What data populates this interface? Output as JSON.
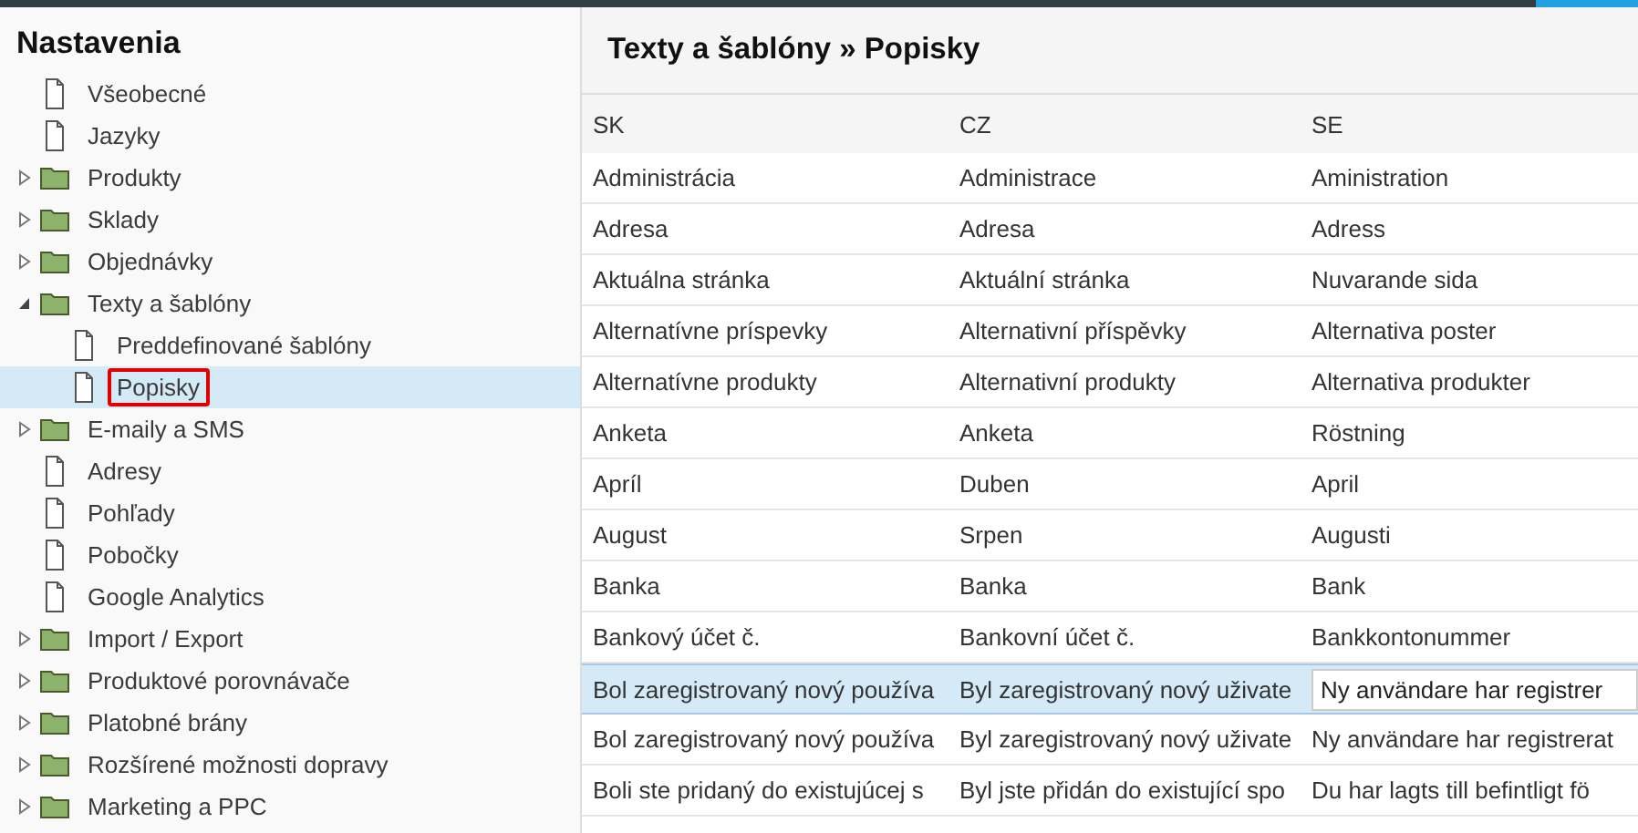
{
  "sidebar": {
    "title": "Nastavenia",
    "items": [
      {
        "label": "Všeobecné",
        "kind": "page",
        "selected": false,
        "marked": false
      },
      {
        "label": "Jazyky",
        "kind": "page",
        "selected": false,
        "marked": false
      },
      {
        "label": "Produkty",
        "kind": "folder",
        "expanded": false,
        "selected": false,
        "marked": false
      },
      {
        "label": "Sklady",
        "kind": "folder",
        "expanded": false,
        "selected": false,
        "marked": false
      },
      {
        "label": "Objednávky",
        "kind": "folder",
        "expanded": false,
        "selected": false,
        "marked": false
      },
      {
        "label": "Texty a šablóny",
        "kind": "folder",
        "expanded": true,
        "selected": false,
        "marked": false,
        "children": [
          {
            "label": "Preddefinované šablóny",
            "kind": "page",
            "selected": false,
            "marked": false
          },
          {
            "label": "Popisky",
            "kind": "page",
            "selected": true,
            "marked": true
          }
        ]
      },
      {
        "label": "E-maily a SMS",
        "kind": "folder",
        "expanded": false,
        "selected": false,
        "marked": false
      },
      {
        "label": "Adresy",
        "kind": "page",
        "selected": false,
        "marked": false
      },
      {
        "label": "Pohľady",
        "kind": "page",
        "selected": false,
        "marked": false
      },
      {
        "label": "Pobočky",
        "kind": "page",
        "selected": false,
        "marked": false
      },
      {
        "label": "Google Analytics",
        "kind": "page",
        "selected": false,
        "marked": false
      },
      {
        "label": "Import / Export",
        "kind": "folder",
        "expanded": false,
        "selected": false,
        "marked": false
      },
      {
        "label": "Produktové porovnávače",
        "kind": "folder",
        "expanded": false,
        "selected": false,
        "marked": false
      },
      {
        "label": "Platobné brány",
        "kind": "folder",
        "expanded": false,
        "selected": false,
        "marked": false
      },
      {
        "label": "Rozšírené možnosti dopravy",
        "kind": "folder",
        "expanded": false,
        "selected": false,
        "marked": false
      },
      {
        "label": "Marketing a PPC",
        "kind": "folder",
        "expanded": false,
        "selected": false,
        "marked": false
      }
    ]
  },
  "main": {
    "title": "Texty a šablóny » Popisky",
    "table": {
      "columns": [
        "SK",
        "CZ",
        "SE"
      ],
      "rows": [
        {
          "selected": false,
          "cells": [
            "Administrácia",
            "Administrace",
            "Aministration"
          ]
        },
        {
          "selected": false,
          "cells": [
            "Adresa",
            "Adresa",
            "Adress"
          ]
        },
        {
          "selected": false,
          "cells": [
            "Aktuálna stránka",
            "Aktuální stránka",
            "Nuvarande sida"
          ]
        },
        {
          "selected": false,
          "cells": [
            "Alternatívne príspevky",
            "Alternativní příspěvky",
            "Alternativa poster"
          ]
        },
        {
          "selected": false,
          "cells": [
            "Alternatívne produkty",
            "Alternativní produkty",
            "Alternativa produkter"
          ]
        },
        {
          "selected": false,
          "cells": [
            "Anketa",
            "Anketa",
            "Röstning"
          ]
        },
        {
          "selected": false,
          "cells": [
            "Apríl",
            "Duben",
            "April"
          ]
        },
        {
          "selected": false,
          "cells": [
            "August",
            "Srpen",
            "Augusti"
          ]
        },
        {
          "selected": false,
          "cells": [
            "Banka",
            "Banka",
            "Bank"
          ]
        },
        {
          "selected": false,
          "cells": [
            "Bankový účet č.",
            "Bankovní účet č.",
            "Bankkontonummer"
          ]
        },
        {
          "selected": true,
          "editing": true,
          "cells": [
            "Bol zaregistrovaný nový používa",
            "Byl zaregistrovaný nový uživate",
            "Ny användare har registrer"
          ]
        },
        {
          "selected": false,
          "cells": [
            "Bol zaregistrovaný nový používa",
            "Byl zaregistrovaný nový uživate",
            "Ny användare har registrerat"
          ]
        },
        {
          "selected": false,
          "cells": [
            "Boli ste pridaný do existujúcej s",
            "Byl jste přidán do existující spo",
            "Du har lagts till befintligt fö"
          ]
        }
      ]
    }
  }
}
